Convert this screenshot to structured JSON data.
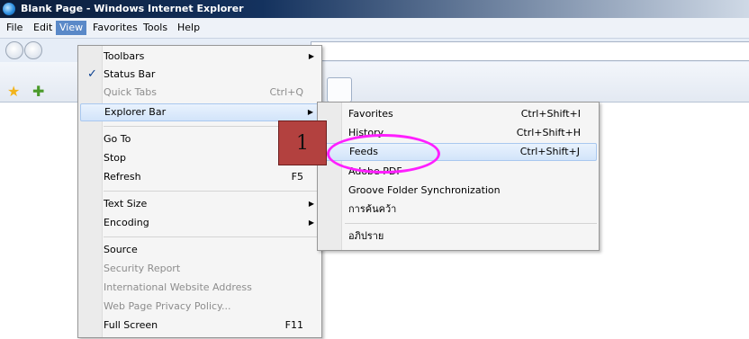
{
  "window": {
    "title": "Blank Page - Windows Internet Explorer"
  },
  "menubar": {
    "items": [
      "File",
      "Edit",
      "View",
      "Favorites",
      "Tools",
      "Help"
    ],
    "active": "View"
  },
  "view_menu": {
    "items": [
      {
        "label": "Toolbars",
        "submenu": true
      },
      {
        "label": "Status Bar",
        "checked": true
      },
      {
        "label": "Quick Tabs",
        "shortcut": "Ctrl+Q",
        "disabled": true
      },
      {
        "label": "Explorer Bar",
        "submenu": true,
        "highlighted": true
      },
      {
        "label": "Go To"
      },
      {
        "label": "Stop"
      },
      {
        "label": "Refresh",
        "shortcut": "F5"
      },
      {
        "label": "Text Size",
        "submenu": true
      },
      {
        "label": "Encoding",
        "submenu": true
      },
      {
        "label": "Source"
      },
      {
        "label": "Security Report",
        "disabled": true
      },
      {
        "label": "International Website Address",
        "disabled": true
      },
      {
        "label": "Web Page Privacy Policy...",
        "disabled": true
      },
      {
        "label": "Full Screen",
        "shortcut": "F11"
      }
    ],
    "check_glyph": "✓",
    "arrow_glyph": "▶"
  },
  "explorer_bar_submenu": {
    "items": [
      {
        "label": "Favorites",
        "shortcut": "Ctrl+Shift+I"
      },
      {
        "label": "History",
        "shortcut": "Ctrl+Shift+H"
      },
      {
        "label": "Feeds",
        "shortcut": "Ctrl+Shift+J",
        "highlighted": true
      },
      {
        "label": "Adobe PDF"
      },
      {
        "label": "Groove Folder Synchronization"
      },
      {
        "label": "การค้นคว้า"
      },
      {
        "label": "อภิปราย"
      }
    ]
  },
  "annotation": {
    "step_number": "1",
    "badge_color": "#b3413f",
    "circle_color": "#ff1fff"
  },
  "icons": {
    "browser": "ie-logo-icon",
    "back": "back-arrow-icon",
    "forward": "forward-arrow-icon",
    "favorites": "star-icon",
    "add_favorite": "add-favorite-icon"
  }
}
